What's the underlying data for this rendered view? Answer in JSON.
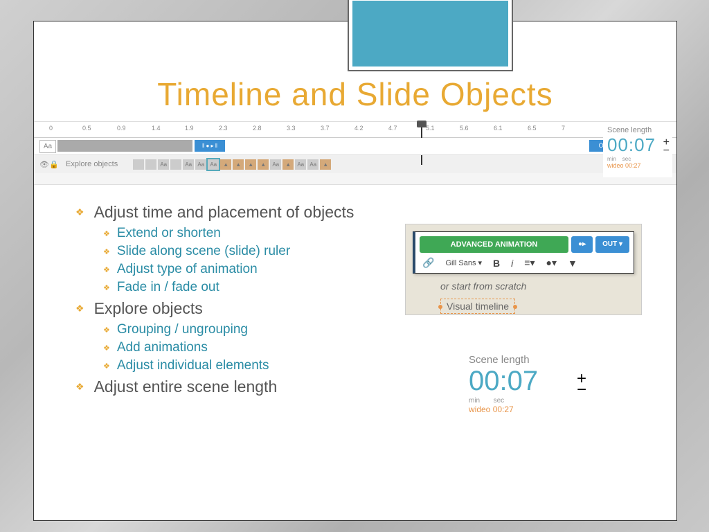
{
  "title": "Timeline and Slide Objects",
  "ruler": [
    "0",
    "0.5",
    "0.9",
    "1.4",
    "1.9",
    "2.3",
    "2.8",
    "3.3",
    "3.7",
    "4.2",
    "4.7",
    "5.1",
    "5.6",
    "6.1",
    "6.5",
    "7"
  ],
  "track": {
    "aa": "Aa",
    "out": "Out ‖"
  },
  "objects_label": "Explore objects",
  "scene": {
    "label": "Scene length",
    "time": "00:07",
    "min": "min",
    "sec": "sec",
    "wideo": "wideo 00:27",
    "plus": "+",
    "minus": "−"
  },
  "bullets": {
    "l1a": "Adjust time and placement of objects",
    "l2a": "Extend or shorten",
    "l2b": "Slide along scene (slide) ruler",
    "l2c": "Adjust type of animation",
    "l2d": "Fade in / fade out",
    "l1b": "Explore objects",
    "l2e": "Grouping / ungrouping",
    "l2f": "Add animations",
    "l2g": "Adjust individual elements",
    "l1c": "Adjust entire scene length"
  },
  "toolbar": {
    "adv": "ADVANCED ANIMATION",
    "toggle": "●▸",
    "out": "OUT ▾",
    "link": "🔗",
    "font": "Gill Sans ▾",
    "bold": "B",
    "italic": "i",
    "align": "≡▾",
    "color": "●▾",
    "more": "▼",
    "scratch": "or start from scratch",
    "vt": "Visual timeline"
  }
}
